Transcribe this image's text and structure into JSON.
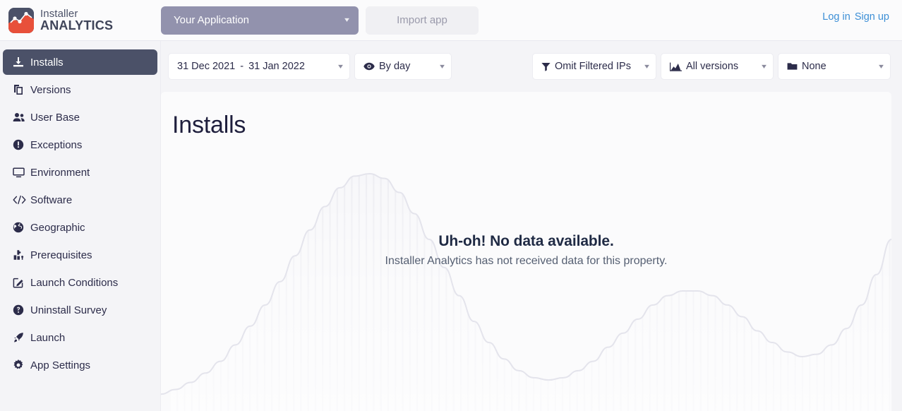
{
  "header": {
    "logo": {
      "line1": "Installer",
      "line2": "ANALYTICS",
      "icon": "chart-logo-icon",
      "dark_color": "#4b5168",
      "accent_color": "#e8503a"
    },
    "app_selector": {
      "label": "Your Application",
      "icon": "chevron-down-icon",
      "color": "#9292ad"
    },
    "import_app_label": "Import app",
    "auth": {
      "login_label": "Log in",
      "signup_label": "Sign up",
      "link_color": "#3d8fd6"
    }
  },
  "sidebar": {
    "active_color": "#4b5168",
    "items": [
      {
        "label": "Installs",
        "icon": "download-icon",
        "active": true
      },
      {
        "label": "Versions",
        "icon": "copy-icon",
        "active": false
      },
      {
        "label": "User Base",
        "icon": "users-icon",
        "active": false
      },
      {
        "label": "Exceptions",
        "icon": "exclamation-circle-icon",
        "active": false
      },
      {
        "label": "Environment",
        "icon": "desktop-icon",
        "active": false
      },
      {
        "label": "Software",
        "icon": "code-icon",
        "active": false
      },
      {
        "label": "Geographic",
        "icon": "globe-icon",
        "active": false
      },
      {
        "label": "Prerequisites",
        "icon": "puzzle-icon",
        "active": false
      },
      {
        "label": "Launch Conditions",
        "icon": "edit-square-icon",
        "active": false
      },
      {
        "label": "Uninstall Survey",
        "icon": "question-circle-icon",
        "active": false
      },
      {
        "label": "Launch",
        "icon": "rocket-icon",
        "active": false
      },
      {
        "label": "App Settings",
        "icon": "gear-icon",
        "active": false
      }
    ]
  },
  "toolbar": {
    "date_range": {
      "start": "31 Dec 2021",
      "separator": "-",
      "end": "31 Jan 2022",
      "caret": "chevron-down-icon"
    },
    "granularity": {
      "label": "By day",
      "icon": "eye-icon",
      "caret": "chevron-down-icon"
    },
    "ip_filter": {
      "label": "Omit Filtered IPs",
      "icon": "filter-icon",
      "caret": "chevron-down-icon"
    },
    "versions_filter": {
      "label": "All versions",
      "icon": "area-chart-icon",
      "caret": "chevron-down-icon"
    },
    "folder_filter": {
      "label": "None",
      "icon": "folder-icon",
      "caret": "chevron-down-icon"
    }
  },
  "main": {
    "title": "Installs",
    "empty_state": {
      "title": "Uh-oh! No data available.",
      "subtitle": "Installer Analytics has not received data for this property."
    }
  },
  "chart_data": {
    "type": "area",
    "title": "Installs",
    "xlabel": "",
    "ylabel": "",
    "grid": false,
    "legend": null,
    "placeholder": true,
    "note": "Faint decorative placeholder waveform shown because no data is available",
    "x": [
      0,
      1,
      2,
      3,
      4,
      5,
      6,
      7,
      8,
      9,
      10,
      11,
      12,
      13,
      14,
      15,
      16,
      17,
      18,
      19,
      20,
      21,
      22,
      23,
      24,
      25,
      26,
      27,
      28,
      29,
      30,
      31,
      32,
      33,
      34,
      35,
      36,
      37,
      38,
      39,
      40,
      41,
      42,
      43,
      44,
      45,
      46,
      47,
      48,
      49
    ],
    "values": [
      6,
      8,
      11,
      15,
      20,
      27,
      35,
      44,
      54,
      65,
      76,
      86,
      94,
      99,
      100,
      98,
      92,
      83,
      72,
      60,
      48,
      37,
      28,
      21,
      16,
      13,
      12,
      13,
      16,
      20,
      26,
      32,
      38,
      44,
      48,
      50,
      50,
      48,
      44,
      39,
      33,
      28,
      24,
      22,
      23,
      27,
      34,
      44,
      57,
      72
    ]
  }
}
